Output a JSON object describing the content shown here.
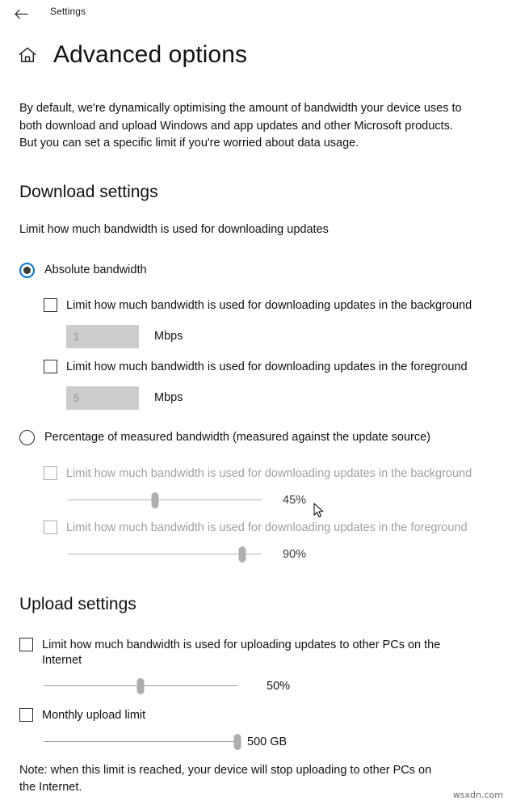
{
  "titlebar": {
    "back_icon": "back-arrow-icon",
    "label": "Settings"
  },
  "header": {
    "home_icon": "home-icon",
    "title": "Advanced options"
  },
  "intro": "By default, we're dynamically optimising the amount of bandwidth your device uses to both download and upload Windows and app updates and other Microsoft products. But you can set a specific limit if you're worried about data usage.",
  "download": {
    "section_title": "Download settings",
    "description": "Limit how much bandwidth is used for downloading updates",
    "absolute": {
      "radio_label": "Absolute bandwidth",
      "selected": true,
      "background": {
        "checkbox_label": "Limit how much bandwidth is used for downloading updates in the background",
        "checked": false,
        "value": "1",
        "unit": "Mbps"
      },
      "foreground": {
        "checkbox_label": "Limit how much bandwidth is used for downloading updates in the foreground",
        "checked": false,
        "value": "5",
        "unit": "Mbps"
      }
    },
    "percentage": {
      "radio_label": "Percentage of measured bandwidth (measured against the update source)",
      "selected": false,
      "background": {
        "checkbox_label": "Limit how much bandwidth is used for downloading updates in the background",
        "checked": false,
        "slider_value": "45%",
        "slider_percent": 45
      },
      "foreground": {
        "checkbox_label": "Limit how much bandwidth is used for downloading updates in the foreground",
        "checked": false,
        "slider_value": "90%",
        "slider_percent": 90
      }
    }
  },
  "upload": {
    "section_title": "Upload settings",
    "bandwidth": {
      "checkbox_label": "Limit how much bandwidth is used for uploading updates to other PCs on the Internet",
      "checked": false,
      "slider_value": "50%",
      "slider_percent": 50
    },
    "monthly": {
      "checkbox_label": "Monthly upload limit",
      "checked": false,
      "slider_value": "500 GB",
      "slider_percent": 100
    },
    "note": "Note: when this limit is reached, your device will stop uploading to other PCs on the Internet."
  },
  "colors": {
    "accent": "#0078d7",
    "disabled_text": "#a0a0a0",
    "field_bg": "#cccccc"
  },
  "watermark": "wsxdn.com"
}
